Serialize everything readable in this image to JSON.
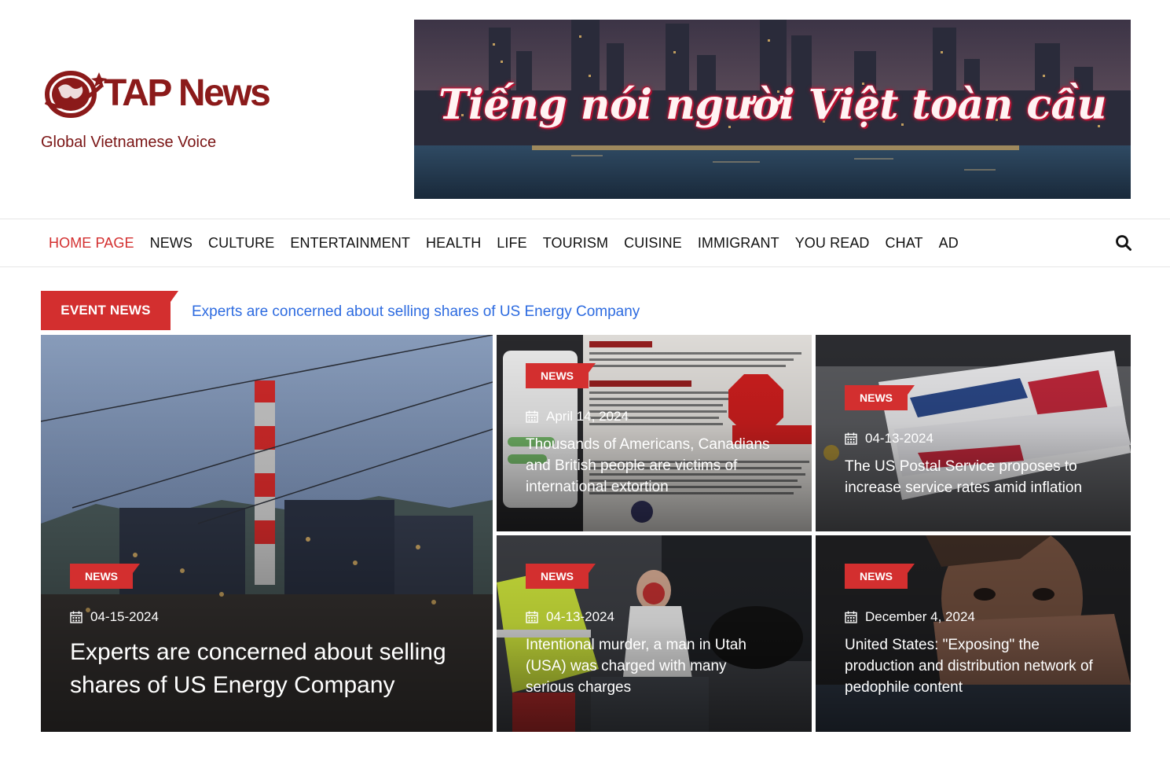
{
  "site": {
    "logo_text": "TAP News",
    "tagline": "Global Vietnamese Voice",
    "banner_text": "Tiếng nói người Việt toàn cầu"
  },
  "nav": {
    "items": [
      {
        "label": "HOME PAGE",
        "active": true
      },
      {
        "label": "NEWS"
      },
      {
        "label": "CULTURE"
      },
      {
        "label": "ENTERTAINMENT"
      },
      {
        "label": "HEALTH"
      },
      {
        "label": "LIFE"
      },
      {
        "label": "TOURISM"
      },
      {
        "label": "CUISINE"
      },
      {
        "label": "IMMIGRANT"
      },
      {
        "label": "YOU READ"
      },
      {
        "label": "CHAT"
      },
      {
        "label": "AD"
      }
    ],
    "search_icon": "search-icon"
  },
  "ticker": {
    "label": "EVENT NEWS",
    "headline": "Experts are concerned about selling shares of US Energy Company"
  },
  "articles": [
    {
      "category": "NEWS",
      "date": "04-15-2024",
      "title": "Experts are concerned about selling shares of US Energy Company"
    },
    {
      "category": "NEWS",
      "date": "April 14, 2024",
      "title": "Thousands of Americans, Canadians and British people are victims of international extortion"
    },
    {
      "category": "NEWS",
      "date": "04-13-2024",
      "title": "The US Postal Service proposes to increase service rates amid inflation"
    },
    {
      "category": "NEWS",
      "date": "04-13-2024",
      "title": "Intentional murder, a man in Utah (USA) was charged with many serious charges"
    },
    {
      "category": "NEWS",
      "date": "December 4, 2024",
      "title": "United States: \"Exposing\" the production and distribution network of pedophile content"
    }
  ],
  "colors": {
    "accent": "#d32f2f",
    "brand": "#8b1a1a",
    "link": "#2d6be0"
  }
}
